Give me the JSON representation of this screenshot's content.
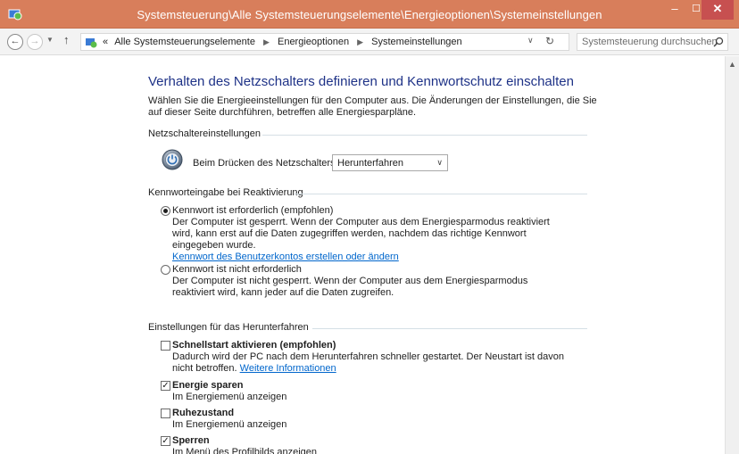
{
  "window": {
    "title": "Systemsteuerung\\Alle Systemsteuerungselemente\\Energieoptionen\\Systemeinstellungen",
    "minimize": "–",
    "maximize": "☐",
    "close": "✕"
  },
  "address": {
    "prefix": "«",
    "crumbs": [
      "Alle Systemsteuerungselemente",
      "Energieoptionen",
      "Systemeinstellungen"
    ],
    "search_placeholder": "Systemsteuerung durchsuchen"
  },
  "page": {
    "title": "Verhalten des Netzschalters definieren und Kennwortschutz einschalten",
    "intro": "Wählen Sie die Energieeinstellungen für den Computer aus. Die Änderungen der Einstellungen, die Sie auf dieser Seite durchführen, betreffen alle Energiesparpläne."
  },
  "power_section": {
    "heading": "Netzschaltereinstellungen",
    "label": "Beim Drücken des Netzschalters:",
    "selected": "Herunterfahren"
  },
  "password_section": {
    "heading": "Kennworteingabe bei Reaktivierung",
    "option1": {
      "label": "Kennwort ist erforderlich (empfohlen)",
      "desc": "Der Computer ist gesperrt. Wenn der Computer aus dem Energiesparmodus reaktiviert wird, kann erst auf die Daten zugegriffen werden, nachdem das richtige Kennwort eingegeben wurde.",
      "link": "Kennwort des Benutzerkontos erstellen oder ändern",
      "selected": true
    },
    "option2": {
      "label": "Kennwort ist nicht erforderlich",
      "desc": "Der Computer ist nicht gesperrt. Wenn der Computer aus dem Energiesparmodus reaktiviert wird, kann jeder auf die Daten zugreifen.",
      "selected": false
    }
  },
  "shutdown_section": {
    "heading": "Einstellungen für das Herunterfahren",
    "fast_startup": {
      "label": "Schnellstart aktivieren (empfohlen)",
      "desc": "Dadurch wird der PC nach dem Herunterfahren schneller gestartet. Der Neustart ist davon nicht betroffen.",
      "link": "Weitere Informationen",
      "checked": false
    },
    "energy_save": {
      "label": "Energie sparen",
      "desc": "Im Energiemenü anzeigen",
      "checked": true
    },
    "hibernate": {
      "label": "Ruhezustand",
      "desc": "Im Energiemenü anzeigen",
      "checked": false
    },
    "lock": {
      "label": "Sperren",
      "desc": "Im Menü des Profilbilds anzeigen",
      "checked": true
    }
  },
  "colors": {
    "titlebar": "#d87e5b",
    "close_button": "#c75050",
    "page_title": "#1e3287",
    "link": "#0066cc"
  }
}
